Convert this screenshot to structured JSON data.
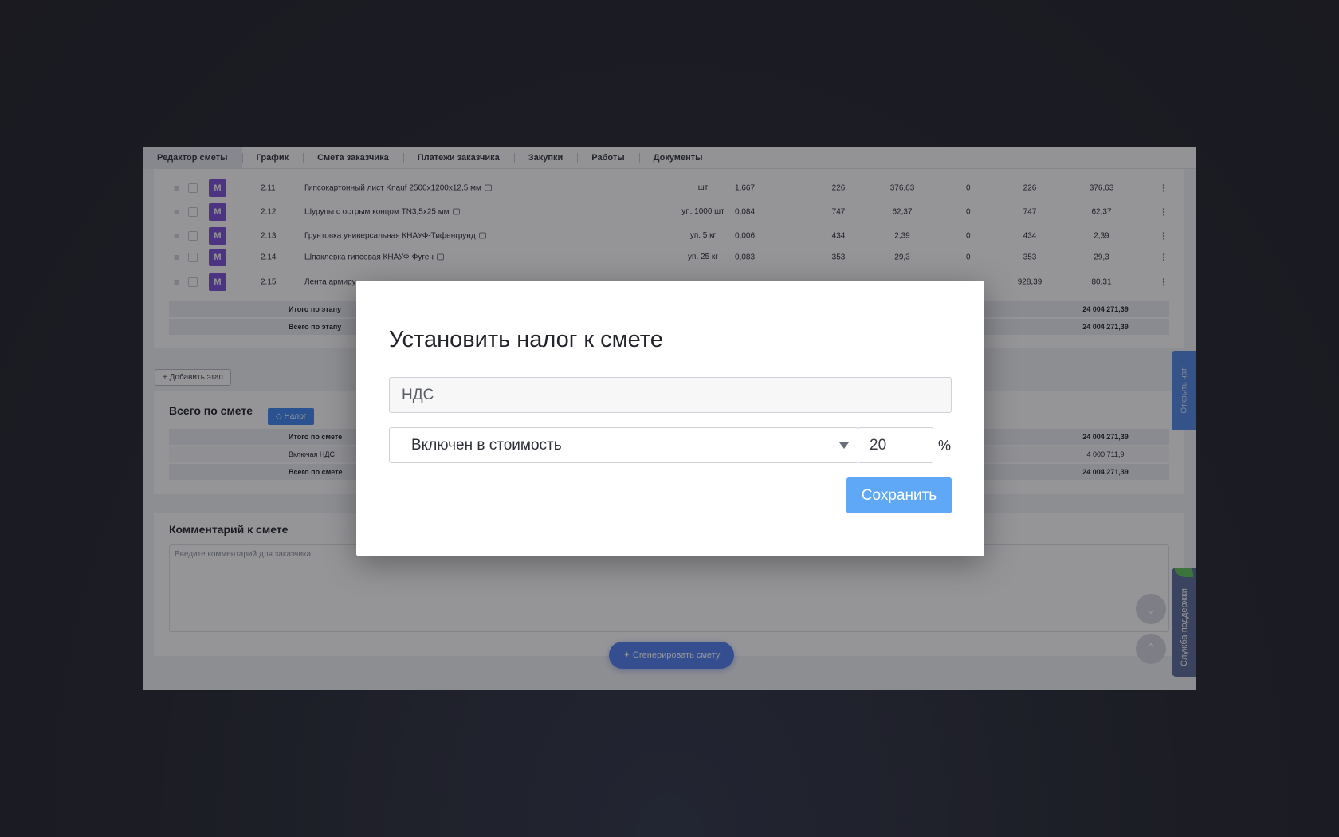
{
  "tabs": [
    {
      "label": "Редактор сметы"
    },
    {
      "label": "График"
    },
    {
      "label": "Смета заказчика"
    },
    {
      "label": "Платежи заказчика"
    },
    {
      "label": "Закупки"
    },
    {
      "label": "Работы"
    },
    {
      "label": "Документы"
    }
  ],
  "table": {
    "badge": "М",
    "rows": [
      {
        "num": "2.11",
        "name": "Гипсокартонный лист Knauf 2500х1200х12,5 мм",
        "unit": "шт",
        "qty": "1,667",
        "price": "226",
        "sum": "376,63",
        "zero": "0",
        "price2": "226",
        "sum2": "376,63"
      },
      {
        "num": "2.12",
        "name": "Шурупы с острым концом TN3,5х25 мм",
        "unit": "уп. 1000 шт",
        "qty": "0,084",
        "price": "747",
        "sum": "62,37",
        "zero": "0",
        "price2": "747",
        "sum2": "62,37"
      },
      {
        "num": "2.13",
        "name": "Грунтовка универсальная КНАУФ-Тифенгрунд",
        "unit": "уп. 5 кг",
        "qty": "0,006",
        "price": "434",
        "sum": "2,39",
        "zero": "0",
        "price2": "434",
        "sum2": "2,39"
      },
      {
        "num": "2.14",
        "name": "Шпаклевка гипсовая КНАУФ-Фуген",
        "unit": "уп. 25 кг",
        "qty": "0,083",
        "price": "353",
        "sum": "29,3",
        "zero": "0",
        "price2": "353",
        "sum2": "29,3"
      },
      {
        "num": "2.15",
        "name": "Лента армиру",
        "unit": "",
        "qty": "",
        "price": "",
        "sum": "",
        "zero": "",
        "price2": "928,39",
        "sum2": "80,31"
      }
    ],
    "stage_total_label": "Итого по этапу",
    "stage_total_value": "24 004 271,39",
    "stage_all_label": "Всего по этапу",
    "stage_all_value": "24 004 271,39"
  },
  "add_stage_label": "+ Добавить этап",
  "estimate_total": {
    "title": "Всего по смете",
    "tax_button": "◇ Налог",
    "itogo_label": "Итого по смете",
    "itogo_value": "24 004 271,39",
    "vat_label": "Включая НДС",
    "vat_value": "4 000 711,9",
    "total_label": "Всего по смете",
    "total_value": "24 004 271,39"
  },
  "comment": {
    "title": "Комментарий к смете",
    "placeholder": "Введите комментарий для заказчика"
  },
  "generate_button": "Сгенерировать смету",
  "chat_tab": "Открыть чат",
  "support_tab": "Служба поддержки",
  "modal": {
    "title": "Установить налог к смете",
    "name_value": "НДС",
    "type_value": "Включен в стоимость",
    "rate_value": "20",
    "percent_sign": "%",
    "save_label": "Сохранить"
  }
}
